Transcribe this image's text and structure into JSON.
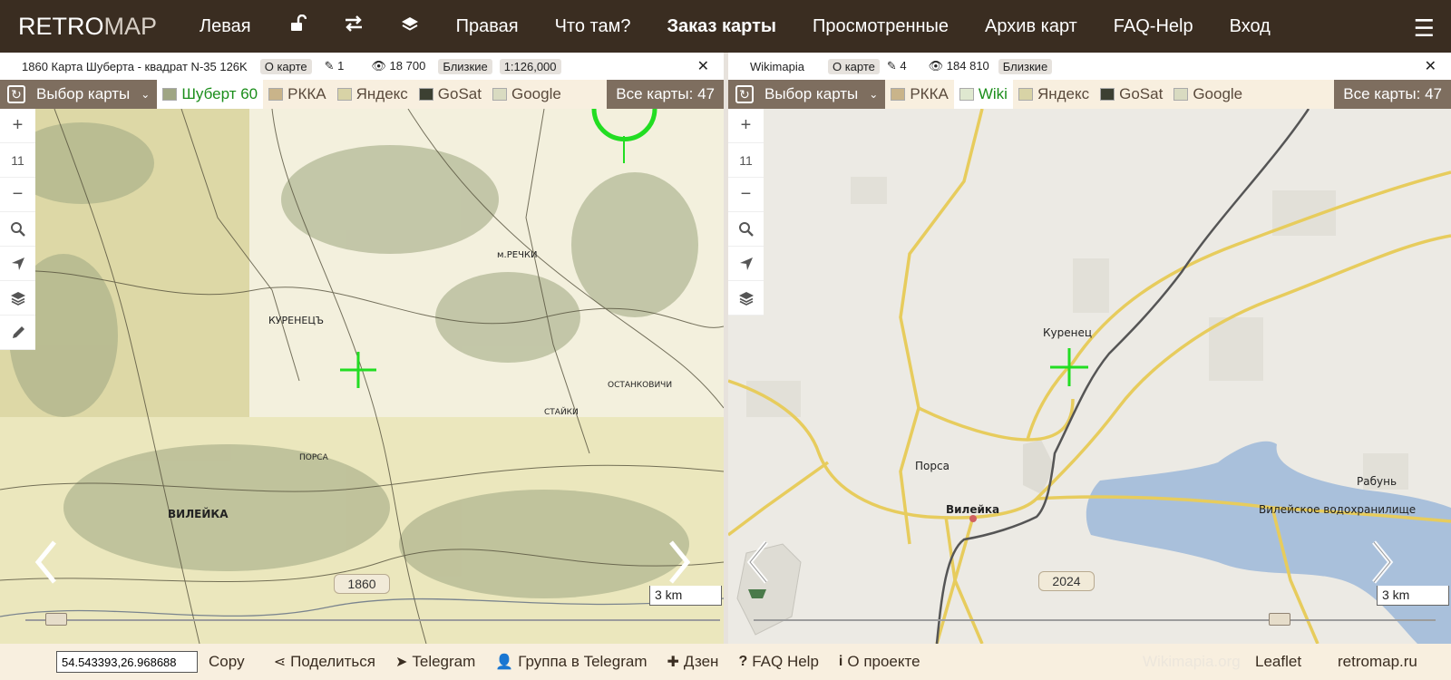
{
  "nav": {
    "logo_bold": "RETRO",
    "logo_light": "MAP",
    "left": "Левая",
    "right": "Правая",
    "whats_there": "Что там?",
    "order_map": "Заказ карты",
    "viewed": "Просмотренные",
    "archive": "Архив карт",
    "faq": "FAQ-Help",
    "login": "Вход",
    "icons": [
      "lock-open-icon",
      "swap-icon",
      "layers-icon",
      "menu-icon"
    ]
  },
  "left_pane": {
    "info": {
      "title": "1860 Карта Шуберта - квадрат N-35 126K",
      "about": "О карте",
      "edits": "1",
      "views": "18 700",
      "nearby": "Близкие",
      "scale": "1:126,000"
    },
    "select_label": "Выбор карты",
    "layers": [
      "Шуберт 60",
      "РККА",
      "Яндекс",
      "GoSat",
      "Google"
    ],
    "active_layer": "Шуберт 60",
    "all_maps": "Все карты: 47",
    "zoom_level": "11",
    "year": "1860",
    "scale_bar": "3 km",
    "slider_fraction": 0.03,
    "map_labels": [
      "КУРЕНЕЦЪ",
      "ВИЛЕЙКА",
      "м.РЕЧКИ",
      "ОСТАНКОВИЧИ",
      "СТАЙКИ",
      "ПОРСА"
    ]
  },
  "right_pane": {
    "info": {
      "title": "Wikimapia",
      "about": "О карте",
      "edits": "4",
      "views": "184 810",
      "nearby": "Близкие"
    },
    "select_label": "Выбор карты",
    "layers": [
      "РККА",
      "Wiki",
      "Яндекс",
      "GoSat",
      "Google"
    ],
    "active_layer": "Wiki",
    "all_maps": "Все карты: 47",
    "zoom_level": "11",
    "year": "2024",
    "scale_bar": "3 km",
    "slider_fraction": 0.78,
    "map_labels": {
      "kurenets": "Куренец",
      "porsa": "Порса",
      "vileyka": "Вилейка",
      "rabun": "Рабунь",
      "reservoir": "Вилейское водохранилище"
    }
  },
  "footer": {
    "coords": "54.543393,26.968688",
    "copy": "Copy",
    "share": "Поделиться",
    "telegram": "Telegram",
    "tg_group": "Группа в Telegram",
    "dzen": "Дзен",
    "faq": "FAQ Help",
    "about": "О проекте",
    "wikimapia": "Wikimapia.org",
    "leaflet": "Leaflet",
    "retromap": "retromap.ru"
  },
  "colors": {
    "nav_bg": "#3a2d21",
    "bar_bg": "#f8efdf",
    "button_bg": "#7e6e5f",
    "active_layer_text": "#1b8e1b",
    "crosshair": "#22dd22"
  }
}
